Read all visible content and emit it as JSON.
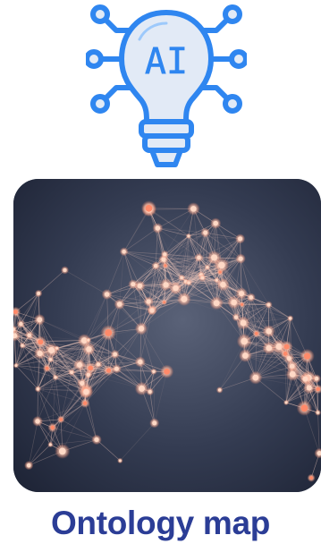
{
  "icon": {
    "name": "ai-lightbulb-icon",
    "label": "AI",
    "colors": {
      "stroke": "#2f86f0",
      "bulb_fill": "#e2eaf6",
      "glow": "#6fb3ff"
    }
  },
  "image": {
    "name": "network-mesh-image",
    "colors": {
      "background": "#2e3648",
      "lines": "#e9c3b8",
      "nodes": "#ffd9c6",
      "accent_nodes": "#ff8a6a"
    }
  },
  "caption": {
    "title": "Ontology map",
    "color": "#2b3d96"
  }
}
